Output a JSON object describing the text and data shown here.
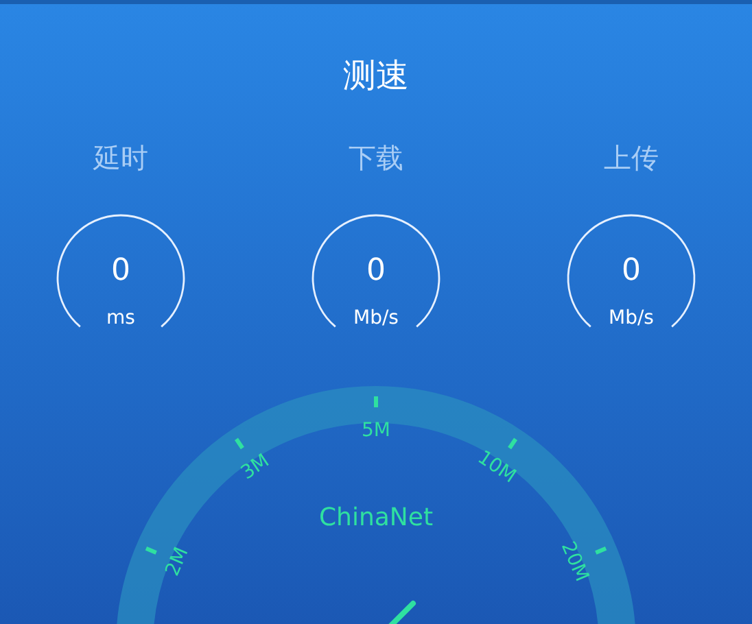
{
  "title": "测速",
  "metrics": [
    {
      "label": "延时",
      "value": "0",
      "unit": "ms"
    },
    {
      "label": "下载",
      "value": "0",
      "unit": "Mb/s"
    },
    {
      "label": "上传",
      "value": "0",
      "unit": "Mb/s"
    }
  ],
  "gauge": {
    "network": "ChinaNet",
    "scale": [
      "2M",
      "3M",
      "5M",
      "10M",
      "20M"
    ]
  }
}
